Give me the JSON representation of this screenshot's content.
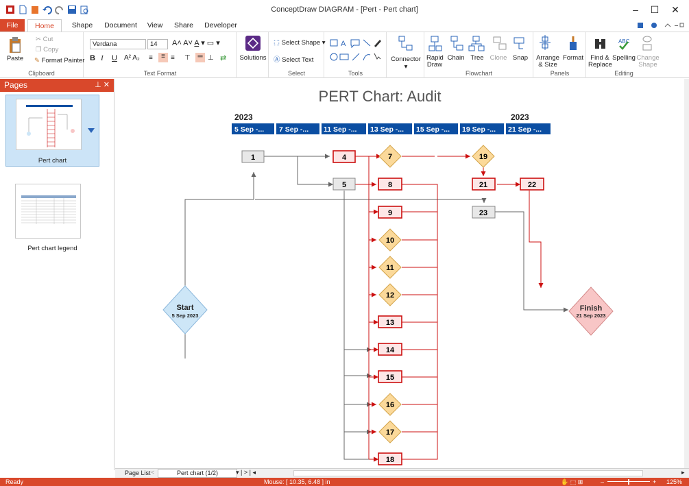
{
  "app": {
    "title": "ConceptDraw DIAGRAM - [Pert - Pert chart]"
  },
  "tabs": [
    "File",
    "Home",
    "Shape",
    "Document",
    "View",
    "Share",
    "Developer"
  ],
  "ribbon": {
    "clipboard": {
      "label": "Clipboard",
      "paste": "Paste",
      "cut": "Cut",
      "copy": "Copy",
      "format_painter": "Format Painter"
    },
    "text_format": {
      "label": "Text Format",
      "font": "Verdana",
      "size": "14"
    },
    "solutions": {
      "label": "Solutions"
    },
    "select": {
      "label": "Select",
      "select_shape": "Select Shape",
      "select_text": "Select Text"
    },
    "tools": {
      "label": "Tools"
    },
    "connector": {
      "label": "Connector"
    },
    "flowchart": {
      "label": "Flowchart",
      "rapid_draw": "Rapid Draw",
      "chain": "Chain",
      "tree": "Tree",
      "clone": "Clone",
      "snap": "Snap"
    },
    "panels": {
      "label": "Panels",
      "arrange_size": "Arrange & Size",
      "format": "Format"
    },
    "editing": {
      "label": "Editing",
      "find_replace": "Find & Replace",
      "spelling": "Spelling",
      "change_shape": "Change Shape"
    }
  },
  "pages_panel": {
    "title": "Pages",
    "pages": [
      {
        "label": "Pert chart"
      },
      {
        "label": "Pert chart legend"
      }
    ]
  },
  "diagram": {
    "title": "PERT Chart: Audit",
    "year_left": "2023",
    "year_right": "2023",
    "timeline": [
      "5 Sep -...",
      "7 Sep -...",
      "11 Sep -...",
      "13 Sep -...",
      "15 Sep -...",
      "19 Sep -...",
      "21 Sep -..."
    ],
    "start": {
      "label": "Start",
      "date": "5 Sep 2023"
    },
    "finish": {
      "label": "Finish",
      "date": "21 Sep 2023"
    },
    "nodes": {
      "n1": "1",
      "n4": "4",
      "n5": "5",
      "n7": "7",
      "n8": "8",
      "n9": "9",
      "n10": "10",
      "n11": "11",
      "n12": "12",
      "n13": "13",
      "n14": "14",
      "n15": "15",
      "n16": "16",
      "n17": "17",
      "n18": "18",
      "n19": "19",
      "n21": "21",
      "n22": "22",
      "n23": "23"
    }
  },
  "pagebar": {
    "page_list": "Page List",
    "current_page": "Pert chart (1/2)"
  },
  "statusbar": {
    "ready": "Ready",
    "mouse": "Mouse: [ 10.35, 6.48 ] in",
    "zoom": "125%"
  },
  "colors": {
    "accent": "#d9482b",
    "timeline_bg": "#0b4ea2",
    "critical": "#cc1010",
    "task_fill": "#fde6e6",
    "neutral_fill": "#e8e8e8",
    "milestone_fill": "#fbd99a",
    "start_fill": "#cde6f7",
    "finish_fill": "#f8c6c6"
  }
}
